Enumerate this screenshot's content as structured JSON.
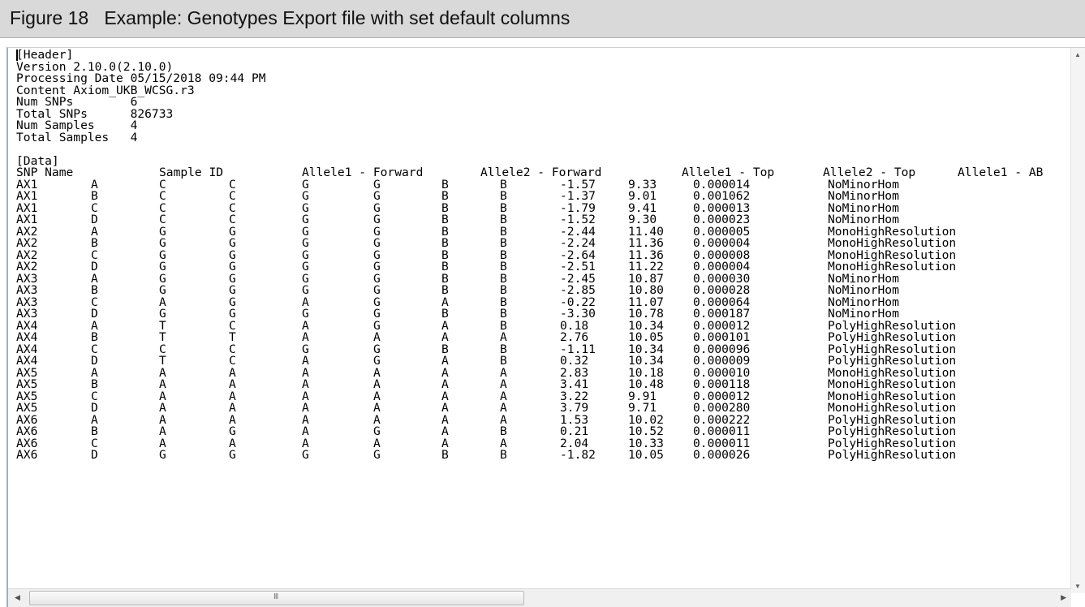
{
  "figure": {
    "caption": "Figure 18   Example: Genotypes Export file with set default columns"
  },
  "file": {
    "header_lines": [
      "[Header]",
      "Version 2.10.0(2.10.0)",
      "Processing Date 05/15/2018 09:44 PM",
      "Content Axiom_UKB_WCSG.r3",
      "Num SNPs        6",
      "Total SNPs      826733",
      "Num Samples     4",
      "Total Samples   4",
      "",
      "[Data]"
    ],
    "columns": [
      "SNP Name",
      "Sample ID",
      "Allele1 - Forward",
      "Allele2 - Forward",
      "Allele1 - Top",
      "Allele2 - Top",
      "Allele1 - AB"
    ],
    "rows": [
      [
        "AX1",
        "A",
        "C",
        "C",
        "G",
        "G",
        "B",
        "B",
        "-1.57",
        "9.33",
        "0.000014",
        "NoMinorHom"
      ],
      [
        "AX1",
        "B",
        "C",
        "C",
        "G",
        "G",
        "B",
        "B",
        "-1.37",
        "9.01",
        "0.001062",
        "NoMinorHom"
      ],
      [
        "AX1",
        "C",
        "C",
        "C",
        "G",
        "G",
        "B",
        "B",
        "-1.79",
        "9.41",
        "0.000013",
        "NoMinorHom"
      ],
      [
        "AX1",
        "D",
        "C",
        "C",
        "G",
        "G",
        "B",
        "B",
        "-1.52",
        "9.30",
        "0.000023",
        "NoMinorHom"
      ],
      [
        "AX2",
        "A",
        "G",
        "G",
        "G",
        "G",
        "B",
        "B",
        "-2.44",
        "11.40",
        "0.000005",
        "MonoHighResolution"
      ],
      [
        "AX2",
        "B",
        "G",
        "G",
        "G",
        "G",
        "B",
        "B",
        "-2.24",
        "11.36",
        "0.000004",
        "MonoHighResolution"
      ],
      [
        "AX2",
        "C",
        "G",
        "G",
        "G",
        "G",
        "B",
        "B",
        "-2.64",
        "11.36",
        "0.000008",
        "MonoHighResolution"
      ],
      [
        "AX2",
        "D",
        "G",
        "G",
        "G",
        "G",
        "B",
        "B",
        "-2.51",
        "11.22",
        "0.000004",
        "MonoHighResolution"
      ],
      [
        "AX3",
        "A",
        "G",
        "G",
        "G",
        "G",
        "B",
        "B",
        "-2.45",
        "10.87",
        "0.000030",
        "NoMinorHom"
      ],
      [
        "AX3",
        "B",
        "G",
        "G",
        "G",
        "G",
        "B",
        "B",
        "-2.85",
        "10.80",
        "0.000028",
        "NoMinorHom"
      ],
      [
        "AX3",
        "C",
        "A",
        "G",
        "A",
        "G",
        "A",
        "B",
        "-0.22",
        "11.07",
        "0.000064",
        "NoMinorHom"
      ],
      [
        "AX3",
        "D",
        "G",
        "G",
        "G",
        "G",
        "B",
        "B",
        "-3.30",
        "10.78",
        "0.000187",
        "NoMinorHom"
      ],
      [
        "AX4",
        "A",
        "T",
        "C",
        "A",
        "G",
        "A",
        "B",
        "0.18",
        "10.34",
        "0.000012",
        "PolyHighResolution"
      ],
      [
        "AX4",
        "B",
        "T",
        "T",
        "A",
        "A",
        "A",
        "A",
        "2.76",
        "10.05",
        "0.000101",
        "PolyHighResolution"
      ],
      [
        "AX4",
        "C",
        "C",
        "C",
        "G",
        "G",
        "B",
        "B",
        "-1.11",
        "10.34",
        "0.000096",
        "PolyHighResolution"
      ],
      [
        "AX4",
        "D",
        "T",
        "C",
        "A",
        "G",
        "A",
        "B",
        "0.32",
        "10.34",
        "0.000009",
        "PolyHighResolution"
      ],
      [
        "AX5",
        "A",
        "A",
        "A",
        "A",
        "A",
        "A",
        "A",
        "2.83",
        "10.18",
        "0.000010",
        "MonoHighResolution"
      ],
      [
        "AX5",
        "B",
        "A",
        "A",
        "A",
        "A",
        "A",
        "A",
        "3.41",
        "10.48",
        "0.000118",
        "MonoHighResolution"
      ],
      [
        "AX5",
        "C",
        "A",
        "A",
        "A",
        "A",
        "A",
        "A",
        "3.22",
        "9.91",
        "0.000012",
        "MonoHighResolution"
      ],
      [
        "AX5",
        "D",
        "A",
        "A",
        "A",
        "A",
        "A",
        "A",
        "3.79",
        "9.71",
        "0.000280",
        "MonoHighResolution"
      ],
      [
        "AX6",
        "A",
        "A",
        "A",
        "A",
        "A",
        "A",
        "A",
        "1.53",
        "10.02",
        "0.000222",
        "PolyHighResolution"
      ],
      [
        "AX6",
        "B",
        "A",
        "G",
        "A",
        "G",
        "A",
        "B",
        "0.21",
        "10.52",
        "0.000011",
        "PolyHighResolution"
      ],
      [
        "AX6",
        "C",
        "A",
        "A",
        "A",
        "A",
        "A",
        "A",
        "2.04",
        "10.33",
        "0.000011",
        "PolyHighResolution"
      ],
      [
        "AX6",
        "D",
        "G",
        "G",
        "G",
        "G",
        "B",
        "B",
        "-1.82",
        "10.05",
        "0.000026",
        "PolyHighResolution"
      ]
    ]
  },
  "scrollbar": {
    "grip_glyph": "III"
  }
}
